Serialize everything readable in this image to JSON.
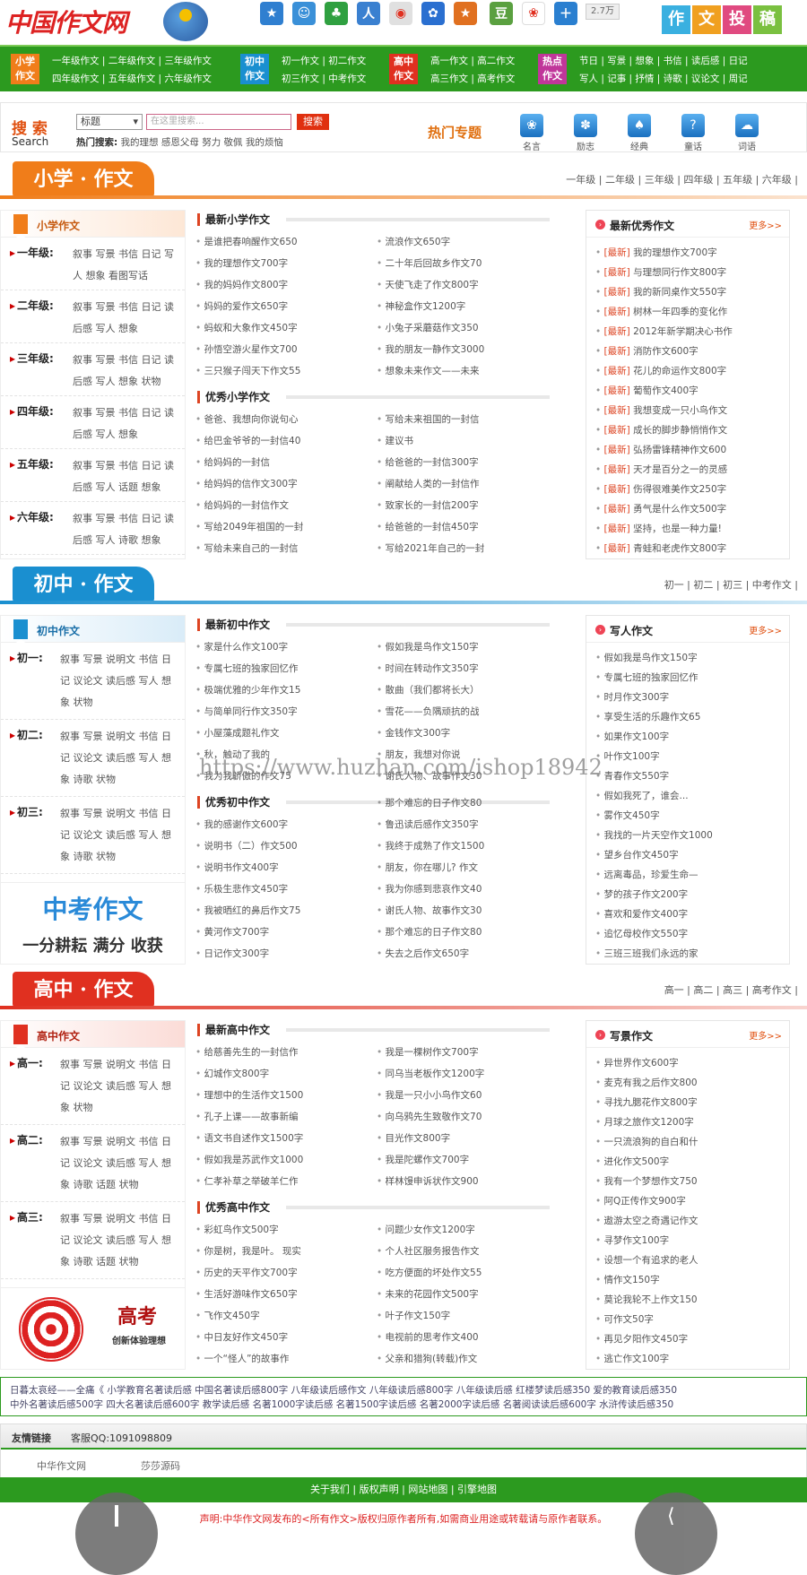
{
  "header": {
    "logo": "中国作文网",
    "counter": "2.7万",
    "submit_chars": [
      "作",
      "文",
      "投",
      "稿"
    ],
    "icons": [
      "star-icon",
      "chat-icon",
      "clover-icon",
      "person-icon",
      "weibo-icon",
      "paw-icon",
      "star2-icon",
      "bean-icon",
      "ribbon-icon",
      "plus-icon"
    ]
  },
  "nav": [
    {
      "cat": [
        "小学",
        "作文"
      ],
      "line1": "一年级作文 | 二年级作文 | 三年级作文",
      "line2": "四年级作文 | 五年级作文 | 六年级作文",
      "color": "#f07d1a"
    },
    {
      "cat": [
        "初中",
        "作文"
      ],
      "line1": "初一作文 | 初二作文",
      "line2": "初三作文 | 中考作文",
      "color": "#1a8fd0"
    },
    {
      "cat": [
        "高中",
        "作文"
      ],
      "line1": "高一作文 | 高二作文",
      "line2": "高三作文 | 高考作文",
      "color": "#e03020"
    },
    {
      "cat": [
        "热点",
        "作文"
      ],
      "line1": "节日 | 写景 | 想象 | 书信 | 读后感 | 日记",
      "line2": "写人 | 记事 | 抒情 | 诗歌 | 议论文 | 周记",
      "color": "#c0369a"
    }
  ],
  "search": {
    "title": "搜 索",
    "sub": "Search",
    "select": "标题",
    "placeholder": "在这里搜索...",
    "button": "搜索",
    "hot_label": "热门搜索:",
    "hot": "我的理想   感恩父母   努力   敬佩   我的烦恼",
    "hot_title": "热门专题",
    "topics": [
      "名言",
      "励志",
      "经典",
      "童话",
      "词语"
    ]
  },
  "primary": {
    "banner": "小学 · 作文",
    "grades": "一年级  |  二年级  |  三年级  |  四年级  |  五年级  |  六年级  |",
    "left_title": "小学作文",
    "rows": [
      {
        "g": "一年级:",
        "items": "叙事 写景 书信 日记 写人 想象 看图写话"
      },
      {
        "g": "二年级:",
        "items": "叙事 写景 书信 日记 读后感 写人 想象"
      },
      {
        "g": "三年级:",
        "items": "叙事 写景 书信 日记 读后感 写人 想象 状物"
      },
      {
        "g": "四年级:",
        "items": "叙事 写景 书信 日记 读后感 写人 想象"
      },
      {
        "g": "五年级:",
        "items": "叙事 写景 书信 日记 读后感 写人 话题 想象"
      },
      {
        "g": "六年级:",
        "items": "叙事 写景 书信 日记 读后感 写人 诗歌 想象"
      }
    ],
    "latest_title": "最新小学作文",
    "latest_a": [
      "是谁把春响醒作文650",
      "我的理想作文700字",
      "我的妈妈作文800字",
      "妈妈的爱作文650字",
      "蚂蚁和大象作文450字",
      "孙悟空游火星作文700",
      "三只猴子闯天下作文55"
    ],
    "latest_b": [
      "流浪作文650字",
      "二十年后回故乡作文70",
      "天使飞走了作文800字",
      "神秘盒作文1200字",
      "小兔子采蘑菇作文350",
      "我的朋友一静作文3000",
      "想象未来作文——未来"
    ],
    "good_title": "优秀小学作文",
    "good_a": [
      "爸爸、我想向你说句心",
      "给巴金爷爷的一封信40",
      "给妈妈的一封信",
      "给妈妈的信作文300字",
      "给妈妈的一封信作文",
      "写给2049年祖国的一封",
      "写给未来自己的一封信"
    ],
    "good_b": [
      "写给未来祖国的一封信",
      "建议书",
      "给爸爸的一封信300字",
      "阐献给人类的一封信作",
      "致家长的一封信200字",
      "给爸爸的一封信450字",
      "写给2021年自己的一封"
    ],
    "right_title": "最新优秀作文",
    "more": "更多>>",
    "tag": "[最新]",
    "right": [
      "我的理想作文700字",
      "与理想同行作文800字",
      "我的新同桌作文550字",
      "树林一年四季的变化作",
      "2012年新学期决心书作",
      "消防作文600字",
      "花儿的命运作文800字",
      "葡萄作文400字",
      "我想变成一只小鸟作文",
      "成长的脚步静悄悄作文",
      "弘扬雷锋精神作文600",
      "天才是百分之一的灵感",
      "伤得很难美作文250字",
      "勇气是什么作文500字",
      "坚持，也是一种力量!",
      "青蛙和老虎作文800字"
    ]
  },
  "middle": {
    "banner": "初中 · 作文",
    "grades": "初一  |  初二  |  初三  |  中考作文  |",
    "left_title": "初中作文",
    "rows": [
      {
        "g": "初一:",
        "items": "叙事 写景 说明文 书信 日记 议论文 读后感 写人 想象 状物"
      },
      {
        "g": "初二:",
        "items": "叙事 写景 说明文 书信 日记 议论文 读后感 写人 想象 诗歌 状物"
      },
      {
        "g": "初三:",
        "items": "叙事 写景 说明文 书信 日记 议论文 读后感 写人 想象 诗歌 状物"
      }
    ],
    "ad_title": "中考作文",
    "ad_sub": "一分耕耘 满分 收获",
    "latest_title": "最新初中作文",
    "latest_a": [
      "家是什么作文100字",
      "专属七班的独家回忆作",
      "极端优雅的少年作文15",
      "与简单同行作文350字",
      "小屋藻成题礼作文",
      "秋，触动了我的",
      "我为我骄傲的作文75"
    ],
    "latest_b": [
      "假如我是鸟作文150字",
      "时间在转动作文350字",
      "散曲（我们都将长大）",
      "雪花——负隅顽抗的战",
      "金钱作文300字",
      "朋友，我想对你说",
      "谢氏人物、故事作文30"
    ],
    "good_title": "优秀初中作文",
    "good_a": [
      "我的感谢作文600字",
      "说明书（二）作文500",
      "说明书作文400字",
      "乐极生悲作文450字",
      "我被晒红的鼻后作文75",
      "黄河作文700字",
      "日记作文300字"
    ],
    "good_b": [
      "那个难忘的日子作文80",
      "鲁迅读后感作文350字",
      "我终于成熟了作文1500",
      "朋友，你在哪儿? 作文",
      "我为你感到悲哀作文40",
      "谢氏人物、故事作文30",
      "那个难忘的日子作文80",
      "失去之后作文650字"
    ],
    "right_title": "写人作文",
    "more": "更多>>",
    "right": [
      "假如我是鸟作文150字",
      "专属七班的独家回忆作",
      "时月作文300字",
      "享受生活的乐趣作文65",
      "如果作文100字",
      "叶作文100字",
      "青春作文550字",
      "假如我死了，谁会...",
      "雾作文450字",
      "我找的一片天空作文1000",
      "望乡台作文450字",
      "远离毒品，珍爱生命—",
      "梦的孩子作文200字",
      "喜欢和爱作文400字",
      "追忆母校作文550字",
      "三班三班我们永远的家"
    ]
  },
  "high": {
    "banner": "高中 · 作文",
    "grades": "高一  |  高二  |  高三  |  高考作文  |",
    "left_title": "高中作文",
    "rows": [
      {
        "g": "高一:",
        "items": "叙事 写景 说明文 书信 日记 议论文 读后感 写人 想象 状物"
      },
      {
        "g": "高二:",
        "items": "叙事 写景 说明文 书信 日记 议论文 读后感 写人 想象 诗歌 话题 状物"
      },
      {
        "g": "高三:",
        "items": "叙事 写景 说明文 书信 日记 议论文 读后感 写人 想象 诗歌 话题 状物"
      }
    ],
    "ad_title": "高考",
    "ad_sub": "创新体验理想",
    "latest_title": "最新高中作文",
    "latest_a": [
      "给慈善先生的一封信作",
      "幻城作文800字",
      "理想中的生活作文1500",
      "孔子上课——故事新编",
      "语文书自述作文1500字",
      "假如我是苏武作文1000",
      "仁孝补草之举破羊仁作"
    ],
    "latest_b": [
      "我是一棵树作文700字",
      "同乌当老板作文1200字",
      "我是一只小小鸟作文60",
      "向乌鸦先生致敬作文70",
      "目光作文800字",
      "我是陀螺作文700字",
      "样林馒申诉状作文900"
    ],
    "good_title": "优秀高中作文",
    "good_a": [
      "彩虹鸟作文500字",
      "你是树，我是叶。 现实",
      "历史的天平作文700字",
      "生活好游味作文650字",
      "飞作文450字",
      "中日友好作文450字",
      "一个“怪人”的故事作"
    ],
    "good_b": [
      "问题少女作文1200字",
      "个人社区服务报告作文",
      "吃方便面的坏处作文55",
      "未来的花园作文500字",
      "叶子作文150字",
      "电视前的思考作文400",
      "父亲和猎狗(转载)作文"
    ],
    "right_title": "写景作文",
    "more": "更多>>",
    "right": [
      "异世界作文600字",
      "麦克有我之后作文800",
      "寻找九腮花作文800字",
      "月球之旅作文1200字",
      "一只流浪狗的自白和什",
      "进化作文500字",
      "我有一个梦想作文750",
      "阿Q正传作文900字",
      "遨游太空之奇遇记作文",
      "寻梦作文100字",
      "设想一个有追求的老人",
      "情作文150字",
      "莫论我轮不上作文150",
      "可作文50字",
      "再见夕阳作文450字",
      "逃亡作文100字"
    ]
  },
  "links": {
    "line1": "日暮太哀经——全痛《   小学教育名著读后感   中国名著读后感800字   八年级读后感作文   八年级读后感800字   八年级读后感   红楼梦读后感350   爱的教育读后感350",
    "line2": "中外名著读后感500字   四大名著读后感600字   教学读后感   名著1000字读后感   名著1500字读后感   名著2000字读后感   名著阅读读后感600字   水浒传读后感350"
  },
  "friend": {
    "title": "友情链接",
    "qq": "客服QQ:1091098809",
    "items": [
      "中华作文网",
      "莎莎源码"
    ]
  },
  "footer": {
    "bar": "关于我们  |  版权声明  |  网站地图  |  引擎地图",
    "copy": "声明:中华作文网发布的<所有作文>版权归原作者所有,如需商业用途或转载请与原作者联系。"
  },
  "watermark": "https://www.huzhan.com/ishop18942"
}
